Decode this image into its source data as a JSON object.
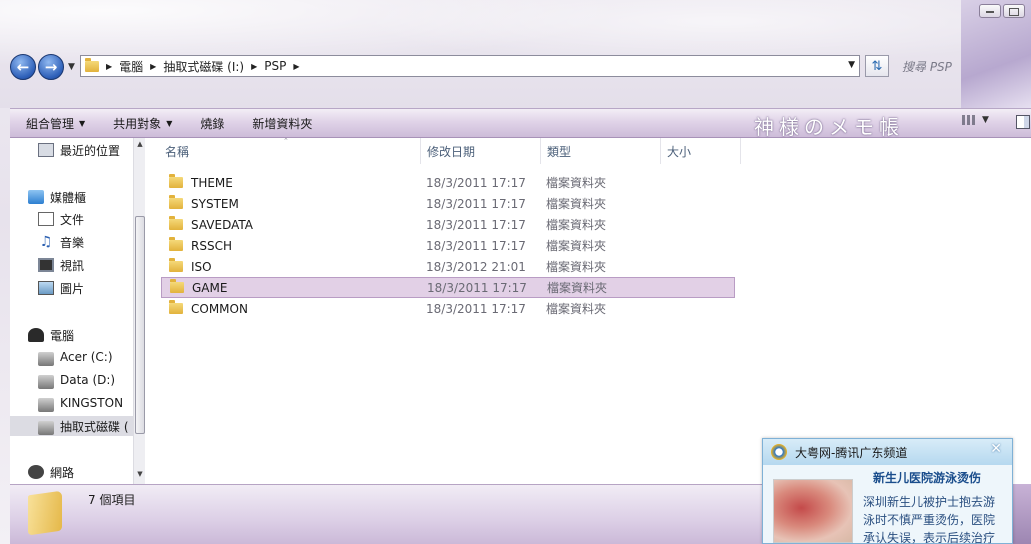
{
  "window": {
    "search_placeholder": "搜尋 PSP",
    "banner_title": "神様のメモ帳"
  },
  "address_bar": {
    "crumbs": [
      "電腦",
      "抽取式磁碟 (I:)",
      "PSP"
    ]
  },
  "toolbar": {
    "organize": "組合管理",
    "share": "共用對象",
    "burn": "燒錄",
    "new_folder": "新增資料夾"
  },
  "sidebar": {
    "items": [
      {
        "label": "最近的位置",
        "icon": "recent-places-icon"
      },
      {
        "label": "媒體櫃",
        "icon": "library-icon"
      },
      {
        "label": "文件",
        "icon": "document-icon"
      },
      {
        "label": "音樂",
        "icon": "music-icon"
      },
      {
        "label": "視訊",
        "icon": "video-icon"
      },
      {
        "label": "圖片",
        "icon": "pictures-icon"
      },
      {
        "label": "電腦",
        "icon": "computer-icon"
      },
      {
        "label": "Acer (C:)",
        "icon": "drive-icon"
      },
      {
        "label": "Data (D:)",
        "icon": "drive-icon"
      },
      {
        "label": "KINGSTON",
        "icon": "usb-drive-icon"
      },
      {
        "label": "抽取式磁碟 (",
        "icon": "usb-drive-icon"
      },
      {
        "label": "網路",
        "icon": "network-icon"
      }
    ],
    "selected_index": 10
  },
  "columns": {
    "name": "名稱",
    "date": "修改日期",
    "type": "類型",
    "size": "大小"
  },
  "files": [
    {
      "name": "THEME",
      "date": "18/3/2011 17:17",
      "type": "檔案資料夾"
    },
    {
      "name": "SYSTEM",
      "date": "18/3/2011 17:17",
      "type": "檔案資料夾"
    },
    {
      "name": "SAVEDATA",
      "date": "18/3/2011 17:17",
      "type": "檔案資料夾"
    },
    {
      "name": "RSSCH",
      "date": "18/3/2011 17:17",
      "type": "檔案資料夾"
    },
    {
      "name": "ISO",
      "date": "18/3/2012 21:01",
      "type": "檔案資料夾"
    },
    {
      "name": "GAME",
      "date": "18/3/2011 17:17",
      "type": "檔案資料夾"
    },
    {
      "name": "COMMON",
      "date": "18/3/2011 17:17",
      "type": "檔案資料夾"
    }
  ],
  "selected_file_index": 5,
  "details": {
    "item_count": "7 個項目"
  },
  "popup": {
    "header": "大粤网-腾讯广东频道",
    "title": "新生儿医院游泳烫伤",
    "body": "深圳新生儿被护士抱去游泳时不慎严重烫伤，医院承认失误，表示后续治疗"
  },
  "colors": {
    "toolbar_accent": "#cdbcd9",
    "selection": "#e2d0e6",
    "header_text": "#4c607a",
    "popup_link": "#1a4d8c"
  }
}
